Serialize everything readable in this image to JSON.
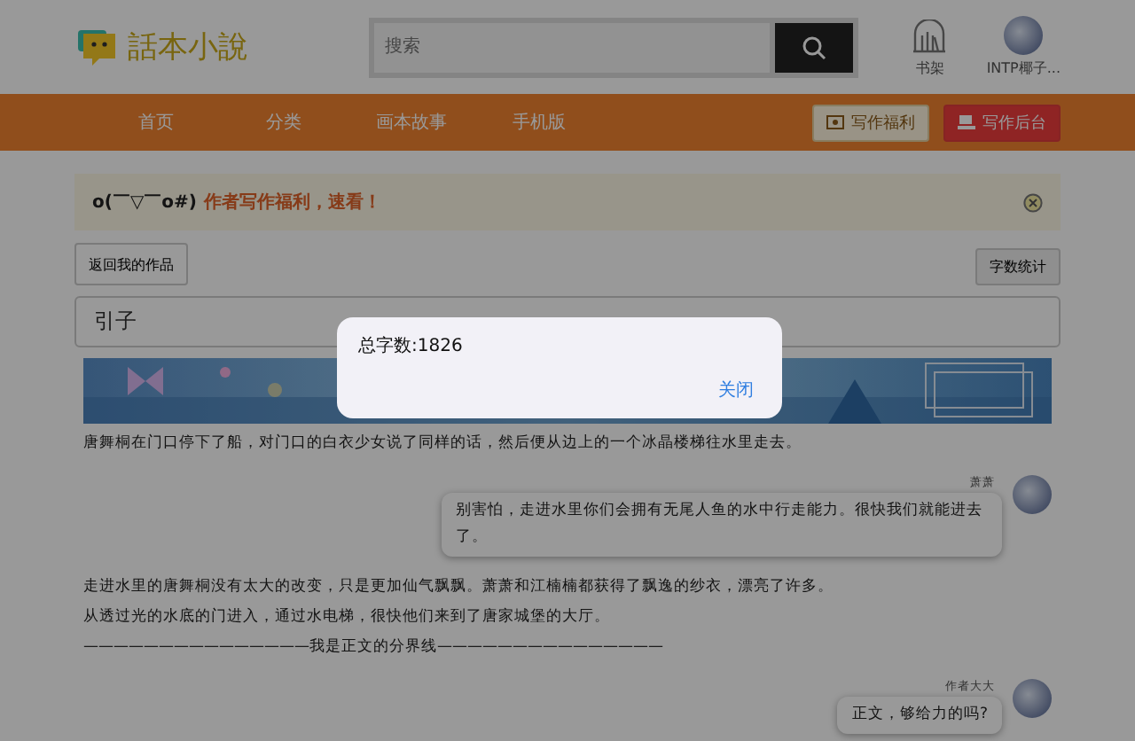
{
  "header": {
    "logo_text": "話本小說",
    "search": {
      "placeholder": "搜索"
    },
    "shelf": {
      "label": "书架"
    },
    "user": {
      "name": "INTP椰子..."
    }
  },
  "nav": {
    "items": [
      {
        "label": "首页"
      },
      {
        "label": "分类"
      },
      {
        "label": "画本故事"
      },
      {
        "label": "手机版"
      }
    ],
    "buttons": [
      {
        "label": "写作福利",
        "kind": "bonus"
      },
      {
        "label": "写作后台",
        "kind": "backend"
      }
    ]
  },
  "notice": {
    "emoticon": "o(￣▽￣o#)",
    "text": "作者写作福利，速看！"
  },
  "toolbar": {
    "back": "返回我的作品",
    "count": "字数统计"
  },
  "chapter_title": "引子",
  "story": [
    {
      "kind": "banner"
    },
    {
      "kind": "text",
      "text": "唐舞桐在门口停下了船，对门口的白衣少女说了同样的话，然后便从边上的一个冰晶楼梯往水里走去。"
    },
    {
      "kind": "chat",
      "speaker": "萧萧",
      "text": "别害怕，走进水里你们会拥有无尾人鱼的水中行走能力。很快我们就能进去了。"
    },
    {
      "kind": "text",
      "text": "走进水里的唐舞桐没有太大的改变，只是更加仙气飘飘。萧萧和江楠楠都获得了飘逸的纱衣，漂亮了许多。"
    },
    {
      "kind": "text",
      "text": "从透过光的水底的门进入，通过水电梯，很快他们来到了唐家城堡的大厅。"
    },
    {
      "kind": "text",
      "text": "———————————————我是正文的分界线———————————————"
    },
    {
      "kind": "chat",
      "speaker": "作者大大",
      "text": "正文，够给力的吗?"
    }
  ],
  "dialog": {
    "message": "总字数:1826",
    "button": "关闭"
  }
}
